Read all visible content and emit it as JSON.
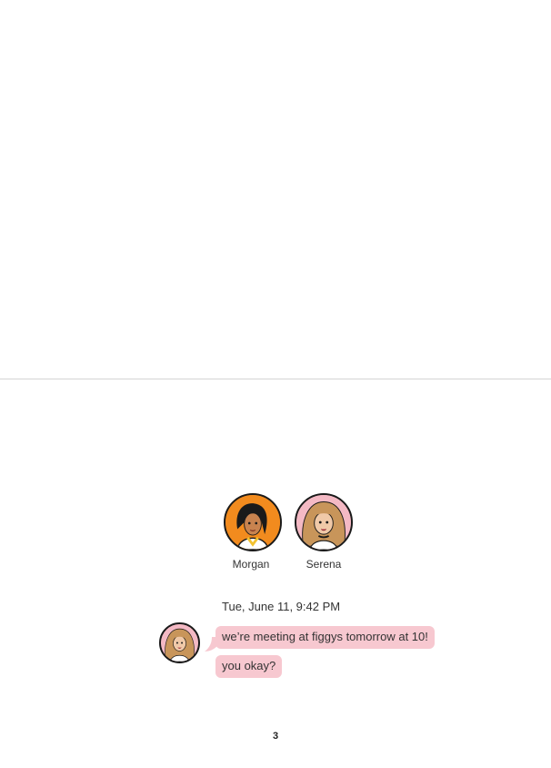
{
  "participants": [
    {
      "name": "Morgan",
      "avatar_icon": "morgan-avatar",
      "bg_color": "#f28b1e"
    },
    {
      "name": "Serena",
      "avatar_icon": "serena-avatar",
      "bg_color": "#f4b9c4"
    }
  ],
  "conversation": {
    "timestamp": "Tue, June 11, 9:42 PM",
    "sender_avatar_icon": "serena-avatar",
    "messages": [
      {
        "text": "we’re meeting at figgys tomorrow at 10!"
      },
      {
        "text": "you okay?"
      }
    ],
    "bubble_color": "#f7c8d0"
  },
  "page_number": "3"
}
